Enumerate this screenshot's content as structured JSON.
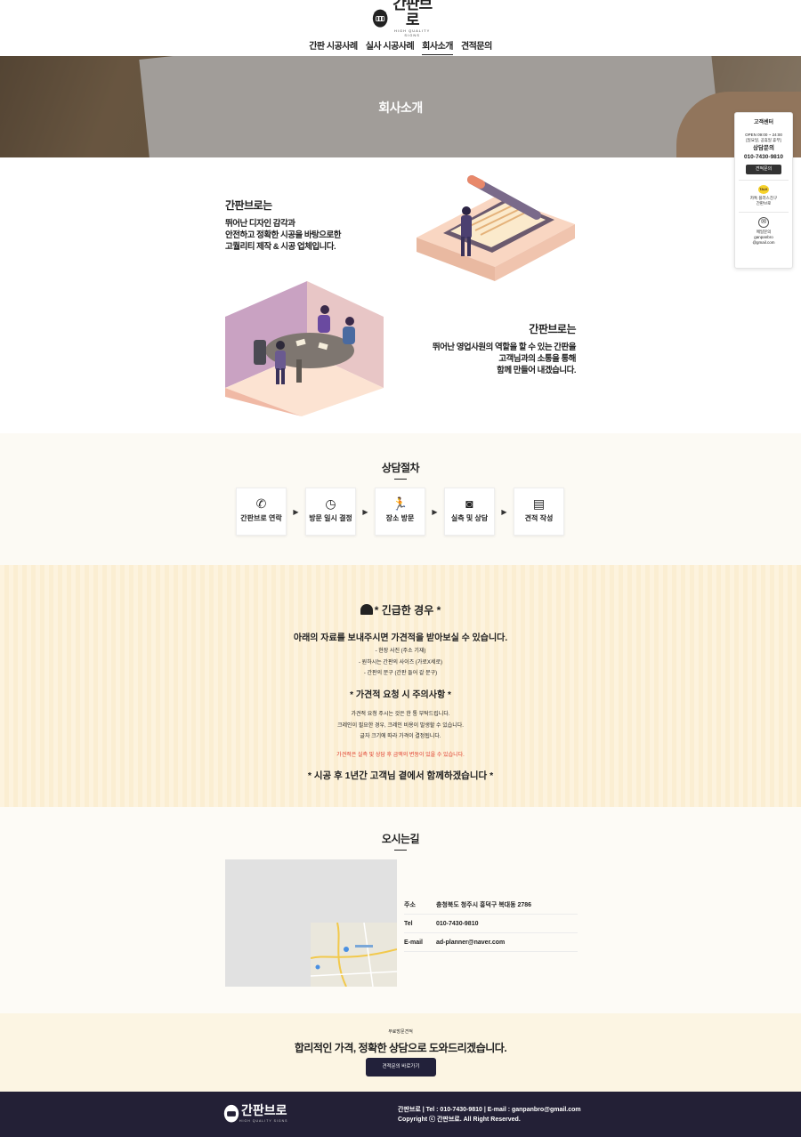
{
  "header": {
    "logo_title": "간판브로",
    "logo_sub": "HIGH QUALITY SIGNS",
    "nav": [
      {
        "label": "간판 시공사례"
      },
      {
        "label": "실사 시공사례"
      },
      {
        "label": "회사소개"
      },
      {
        "label": "견적문의"
      }
    ]
  },
  "hero": {
    "title": "회사소개"
  },
  "side_widget": {
    "title": "고객센터",
    "hours": "OPEN 09:00 ~ 24:00",
    "hours_note": "[일요일, 공휴일 휴무]",
    "consult_label": "상담문의",
    "phone": "010-7430-9810",
    "quote_button": "견적문의",
    "kakao_icon_text": "TALK",
    "kakao_label": "카톡 플러스친구",
    "kakao_name": "간판브로",
    "mail_label": "메일문의",
    "mail_user": "ganpanbro",
    "mail_domain": "@gmail.com"
  },
  "about": {
    "block1": {
      "title": "간판브로는",
      "line1": "뛰어난 디자인 감각과",
      "line2": "안전하고 정확한 시공을 바탕으로한",
      "line3": "고퀄리티 제작 & 시공 업체입니다."
    },
    "block2": {
      "title": "간판브로는",
      "line1": "뛰어난 영업사원의 역할을 할 수 있는 간판을",
      "line2": "고객님과의 소통을 통해",
      "line3": "함께 만들어 내겠습니다."
    }
  },
  "process": {
    "title": "상담절차",
    "steps": [
      {
        "label": "간판브로 연락"
      },
      {
        "label": "방문 일시 결정"
      },
      {
        "label": "장소 방문"
      },
      {
        "label": "실측 및 상담"
      },
      {
        "label": "견적 작성"
      }
    ]
  },
  "urgent": {
    "title": "* 긴급한 경우 *",
    "subtitle": "아래의 자료를 보내주시면 가견적을 받아보실 수 있습니다.",
    "items": [
      "- 현장 사진 (주소 기재)",
      "- 원하시는 간판의 사이즈 (가로X세로)",
      "- 간판의 문구 (간판 들어 갈 문구)"
    ],
    "caution_title": "* 가견적 요청 시 주의사항 *",
    "caution_items": [
      "가견적 요청 주시는 것은 한 통 부탁드립니다.",
      "크레인이 필요한 경우, 크레인 비용이 발생할 수 있습니다.",
      "글자 크기에 따라 가격이 결정됩니다."
    ],
    "red_note": "가견적은 실측 및 상담 후 금액의 변동이 있을 수 있습니다.",
    "final": "* 시공 후 1년간 고객님 곁에서 함께하겠습니다 *"
  },
  "directions": {
    "title": "오시는길",
    "rows": [
      {
        "key": "주소",
        "value": "충청북도 청주시 흥덕구 복대동 2786"
      },
      {
        "key": "Tel",
        "value": "010-7430-9810"
      },
      {
        "key": "E-mail",
        "value": "ad-planner@naver.com"
      }
    ]
  },
  "cta": {
    "small": "무료방문견적",
    "big": "합리적인 가격, 정확한 상담으로 도와드리겠습니다.",
    "button": "견적문의 바로가기"
  },
  "footer": {
    "logo_title": "간판브로",
    "logo_sub": "HIGH QUALITY SIGNS",
    "line1": "간판브로 | Tel : 010-7430-9810 | E-mail : ganpanbro@gmail.com",
    "line2": "Copyright ⓒ 간판브로. All Right Reserved."
  }
}
